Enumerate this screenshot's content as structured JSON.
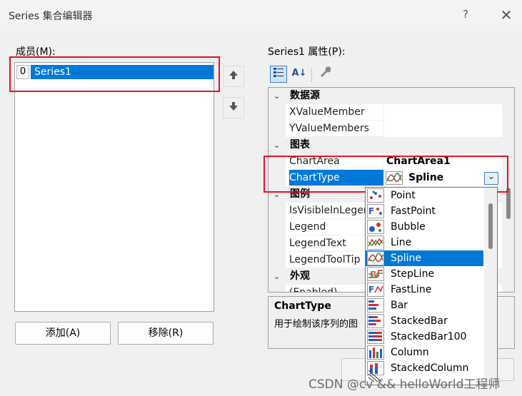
{
  "window": {
    "title": "Series 集合编辑器",
    "help": "?",
    "close": "✕"
  },
  "members": {
    "label": "成员(M):",
    "items": [
      {
        "index": "0",
        "name": "Series1"
      }
    ],
    "move_up": "🡅",
    "move_down": "🡇"
  },
  "buttons": {
    "add": "添加(A)",
    "remove": "移除(R)"
  },
  "properties": {
    "label": "Series1 属性(P):",
    "toolbar": {
      "categorized": "▦",
      "alphabetical": "A↓",
      "property_pages": "🔧"
    },
    "categories": [
      {
        "name": "数据源",
        "rows": [
          {
            "name": "XValueMember",
            "value": ""
          },
          {
            "name": "YValueMembers",
            "value": ""
          }
        ]
      },
      {
        "name": "图表",
        "rows": [
          {
            "name": "ChartArea",
            "value": "ChartArea1"
          },
          {
            "name": "ChartType",
            "value": "Spline"
          }
        ]
      },
      {
        "name": "图例",
        "rows": [
          {
            "name": "IsVisibleInLegend",
            "value": ""
          },
          {
            "name": "Legend",
            "value": ""
          },
          {
            "name": "LegendText",
            "value": ""
          },
          {
            "name": "LegendToolTip",
            "value": ""
          }
        ]
      },
      {
        "name": "外观",
        "rows": [
          {
            "name": "(Enabled)",
            "value": ""
          }
        ]
      }
    ],
    "expand_glyph": "⌄",
    "dropdown_glyph": "⌄"
  },
  "description": {
    "title": "ChartType",
    "text": "用于绘制该序列的图"
  },
  "chart_types": {
    "options": [
      "Point",
      "FastPoint",
      "Bubble",
      "Line",
      "Spline",
      "StepLine",
      "FastLine",
      "Bar",
      "StackedBar",
      "StackedBar100",
      "Column",
      "StackedColumn"
    ],
    "selected": "Spline"
  },
  "watermark": "CSDN @cv && helloWorld工程师",
  "colors": {
    "selection": "#0078d7",
    "highlight_box": "#e81123"
  }
}
